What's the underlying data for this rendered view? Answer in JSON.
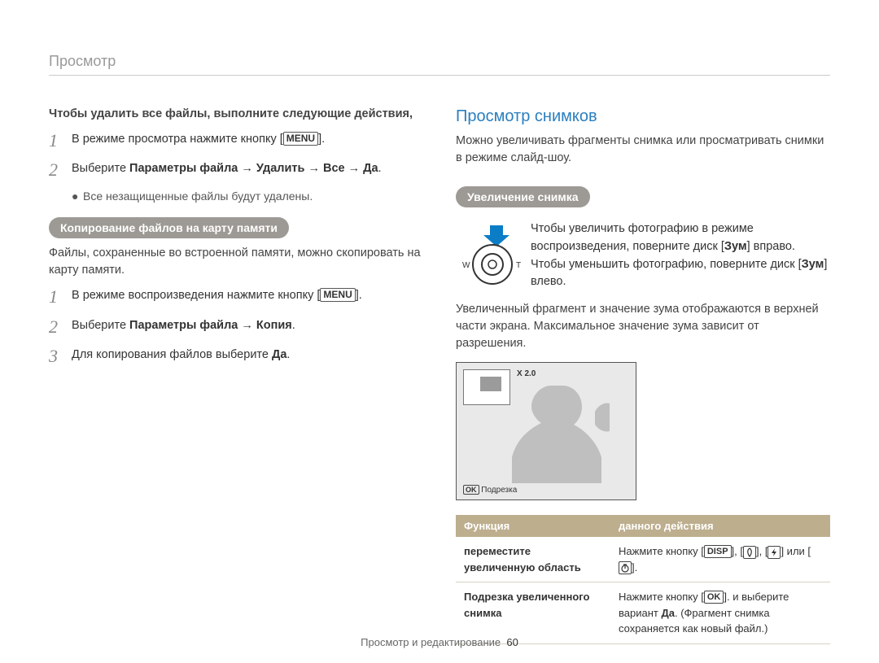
{
  "section_title": "Просмотр",
  "left": {
    "delete_all_heading": "Чтобы удалить все файлы, выполните следующие действия,",
    "step1_pre": "В режиме просмотра нажмите кнопку [",
    "step1_btn": "MENU",
    "step1_post": "].",
    "step2_pre": "Выберите ",
    "step2_bold": "Параметры файла → Удалить → Все → Да",
    "step2_post": ".",
    "bullet1": "Все незащищенные файлы будут удалены.",
    "copy_pill": "Копирование файлов на карту памяти",
    "copy_intro": "Файлы, сохраненные во встроенной памяти, можно скопировать на карту памяти.",
    "cstep1_pre": "В режиме воспроизведения нажмите кнопку [",
    "cstep1_btn": "MENU",
    "cstep1_post": "].",
    "cstep2_pre": "Выберите ",
    "cstep2_bold": "Параметры файла → Копия",
    "cstep2_post": ".",
    "cstep3_pre": "Для копирования файлов выберите ",
    "cstep3_bold": "Да",
    "cstep3_post": "."
  },
  "right": {
    "heading": "Просмотр снимков",
    "intro": "Можно увеличивать фрагменты снимка или просматривать снимки в режиме слайд-шоу.",
    "zoom_pill": "Увеличение снимка",
    "zoom_text_pre": "Чтобы увеличить фотографию в режиме воспроизведения, поверните диск [",
    "zoom_text_b1": "Зум",
    "zoom_text_mid": "] вправо. Чтобы уменьшить фотографию, поверните диск [",
    "zoom_text_b2": "Зум",
    "zoom_text_post": "] влево.",
    "zoom_dial_left": "W",
    "zoom_dial_right": "T",
    "zoom_note": "Увеличенный фрагмент и значение зума отображаются в верхней части экрана. Максимальное значение зума зависит от разрешения.",
    "preview_zoom": "X 2.0",
    "preview_ok": "OK",
    "preview_ok_label": "Подрезка",
    "table": {
      "h1": "Функция",
      "h2": "данного действия",
      "r1c1": "переместите увеличенную область",
      "r1c2_pre": "Нажмите кнопку [",
      "r1c2_disp": "DISP",
      "r1c2_mid1": "], [",
      "r1c2_mid2": "], [",
      "r1c2_mid3": "] или [",
      "r1c2_post": "].",
      "r2c1": "Подрезка увеличенного снимка",
      "r2c2_pre": "Нажмите кнопку [",
      "r2c2_ok": "OK",
      "r2c2_mid": "]. и выберите вариант ",
      "r2c2_b": "Да",
      "r2c2_post": ". (Фрагмент снимка сохраняется как новый файл.)"
    }
  },
  "footer": {
    "label": "Просмотр и редактирование",
    "page": "60"
  }
}
